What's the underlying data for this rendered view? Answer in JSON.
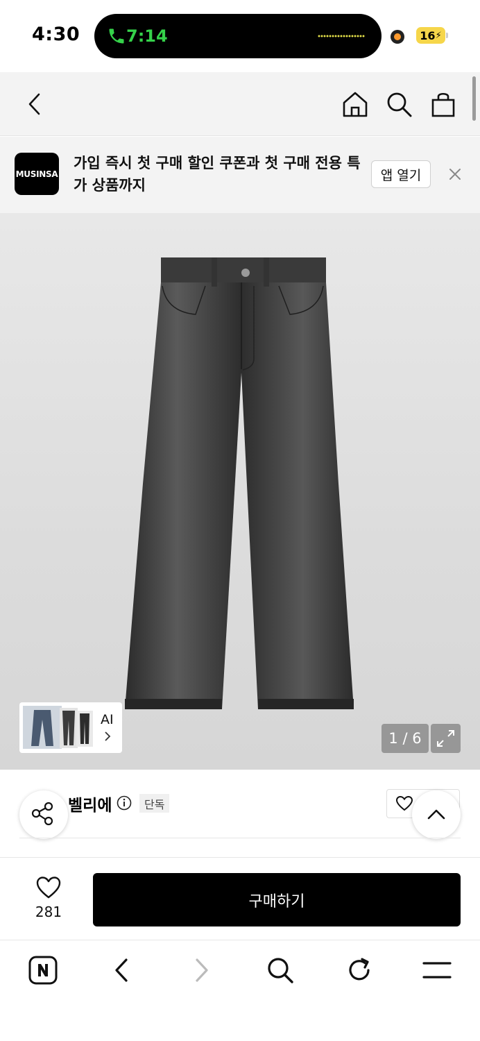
{
  "status_bar": {
    "time": "4:30",
    "call_time": "7:14",
    "battery": "16"
  },
  "banner": {
    "logo_text": "MUSINSA",
    "message": "가입 즉시 첫 구매 할인 쿠폰과 첫 구매 전용 특가 상품까지",
    "open_app_label": "앱 열기"
  },
  "gallery": {
    "ai_label": "AI",
    "counter": "1 / 6"
  },
  "product": {
    "brand": "벨리에",
    "tag": "단독"
  },
  "purchase_bar": {
    "like_count": "281",
    "buy_label": "구매하기"
  },
  "colors": {
    "call_green": "#35d24a",
    "battery_yellow": "#f6d64a",
    "header_bg": "#f3f3f3",
    "buy_button": "#000000"
  },
  "icons": {
    "header": [
      "back-icon",
      "home-icon",
      "search-icon",
      "bag-icon"
    ],
    "toolbar": [
      "naver-icon",
      "browser-back-icon",
      "browser-forward-icon",
      "browser-search-icon",
      "reload-icon",
      "menu-icon"
    ]
  }
}
